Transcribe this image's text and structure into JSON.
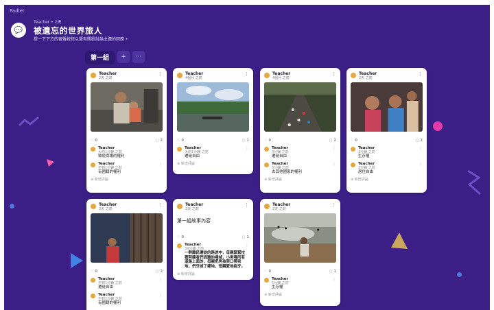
{
  "app": {
    "brand": "Padlet"
  },
  "header": {
    "meta": "Teacher • 2天",
    "title": "被遺忘的世界旅人",
    "subtitle": "提一下下方的留聲按鈕以暨有關劉討論主題的回應 •"
  },
  "section": {
    "title": "第一組",
    "add_label": "+",
    "more_label": "···"
  },
  "cards": [
    {
      "author": "Teacher",
      "time": "2天 之前",
      "image": "man-carrying-child",
      "likes": "0",
      "comments_count": "2",
      "comments": [
        {
          "author": "Teacher",
          "time": "大約1分鐘 之前",
          "body": "致使保護的權利"
        },
        {
          "author": "Teacher",
          "time": "不到1分鐘 之前",
          "body": "有國籍的權利"
        }
      ],
      "add_comment": "新增評論"
    },
    {
      "author": "Teacher",
      "time": "4個月 之前",
      "image": "river-crossing",
      "likes": "0",
      "comments_count": "1",
      "comments": [
        {
          "author": "Teacher",
          "time": "大約1分鐘 之前",
          "body": "遷徙自由"
        }
      ],
      "add_comment": "新增評論"
    },
    {
      "author": "Teacher",
      "time": "4個月 之前",
      "image": "crowd-on-road",
      "likes": "0",
      "comments_count": "2",
      "comments": [
        {
          "author": "Teacher",
          "time": "3分鐘 之前",
          "body": "遷徙自由"
        },
        {
          "author": "Teacher",
          "time": "3分鐘 之前",
          "body": "去其他國家的權利"
        }
      ],
      "add_comment": "新增評論"
    },
    {
      "author": "Teacher",
      "time": "2天 之前",
      "image": "crying-girl",
      "likes": "0",
      "comments_count": "2",
      "comments": [
        {
          "author": "Teacher",
          "time": "3分鐘 之前",
          "body": "生存權"
        },
        {
          "author": "Teacher",
          "time": "2分鐘 之前",
          "body": "居住自由"
        }
      ],
      "add_comment": "新增評論"
    },
    {
      "author": "Teacher",
      "time": "2天 之前",
      "image": "border-fence",
      "likes": "0",
      "comments_count": "2",
      "comments": [
        {
          "author": "Teacher",
          "time": "不到1分鐘 之前",
          "body": "遷徙自由"
        },
        {
          "author": "Teacher",
          "time": "不到1分鐘 之前",
          "body": "有國籍的權利"
        }
      ],
      "add_comment": "新增評論"
    },
    {
      "author": "Teacher",
      "time": "2天 之前",
      "text_body": "第一組故事內容",
      "likes": "0",
      "comments_count": "1",
      "comments": [
        {
          "author": "Teacher",
          "time": "34分鐘 之前",
          "body": "一群難民遷徙的路途中，母親緊緊拉著阿薩者們逃難的場域，小男嗎所有道路上面的，母親把男孩哭口帶到地，們牙掉了哪地，母親緊地抱牙。",
          "long": true
        }
      ],
      "add_comment": "新增評論"
    },
    {
      "author": "Teacher",
      "time": "2天 之前",
      "image": "tear-gas-field",
      "likes": "0",
      "comments_count": "1",
      "comments": [
        {
          "author": "Teacher",
          "time": "5分鐘 之前",
          "body": "生存權"
        }
      ],
      "add_comment": "新增評論"
    }
  ],
  "colors": {
    "board_bg": "#3b1f87",
    "accent": "#e5a83d"
  }
}
